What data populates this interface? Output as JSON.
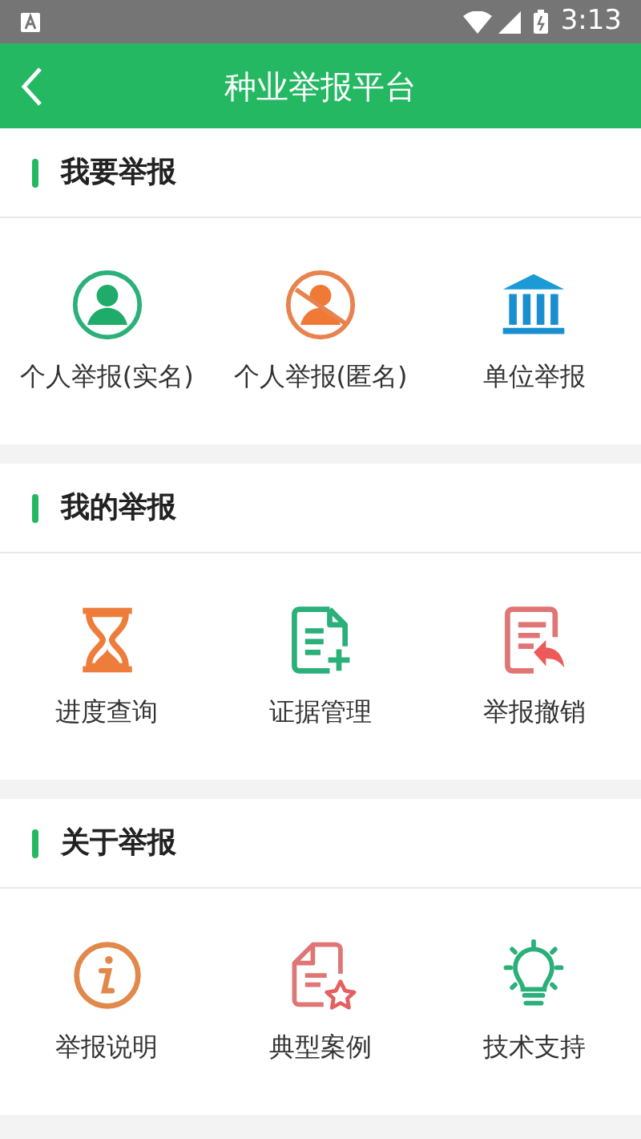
{
  "status_bar": {
    "time": "3:13"
  },
  "header": {
    "title": "种业举报平台"
  },
  "sections": [
    {
      "title": "我要举报",
      "items": [
        {
          "label": "个人举报(实名)"
        },
        {
          "label": "个人举报(匿名)"
        },
        {
          "label": "单位举报"
        }
      ]
    },
    {
      "title": "我的举报",
      "items": [
        {
          "label": "进度查询"
        },
        {
          "label": "证据管理"
        },
        {
          "label": "举报撤销"
        }
      ]
    },
    {
      "title": "关于举报",
      "items": [
        {
          "label": "举报说明"
        },
        {
          "label": "典型案例"
        },
        {
          "label": "技术支持"
        }
      ]
    }
  ]
}
